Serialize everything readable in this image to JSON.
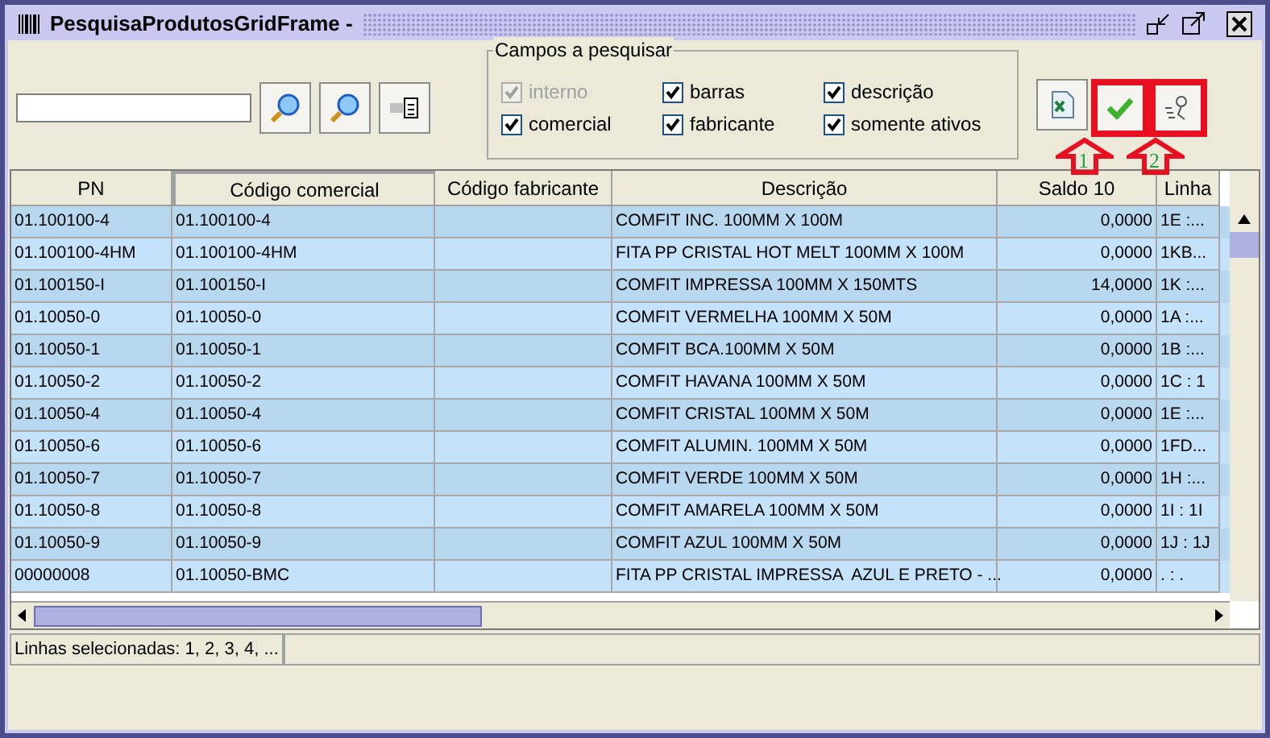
{
  "window": {
    "title": "PesquisaProdutosGridFrame -"
  },
  "fields_group": {
    "title": "Campos a pesquisar",
    "options": [
      {
        "label": "interno",
        "checked": true,
        "disabled": true
      },
      {
        "label": "comercial",
        "checked": true,
        "disabled": false
      },
      {
        "label": "barras",
        "checked": true,
        "disabled": false
      },
      {
        "label": "fabricante",
        "checked": true,
        "disabled": false
      },
      {
        "label": "descrição",
        "checked": true,
        "disabled": false
      },
      {
        "label": "somente ativos",
        "checked": true,
        "disabled": false
      }
    ]
  },
  "table": {
    "columns": [
      {
        "label": "PN",
        "sorted": false
      },
      {
        "label": "Código comercial",
        "sorted": true
      },
      {
        "label": "Código fabricante",
        "sorted": false
      },
      {
        "label": "Descrição",
        "sorted": false
      },
      {
        "label": "Saldo 10",
        "sorted": false
      },
      {
        "label": "Linha",
        "sorted": false
      }
    ],
    "rows": [
      {
        "selected": true,
        "cells": [
          "01.100100-4",
          "01.100100-4",
          "",
          "COMFIT INC. 100MM X 100M",
          "0,0000",
          "1E :..."
        ]
      },
      {
        "selected": true,
        "cells": [
          "01.100100-4HM",
          "01.100100-4HM",
          "",
          "FITA PP CRISTAL HOT MELT 100MM X 100M",
          "0,0000",
          "1KB..."
        ]
      },
      {
        "selected": true,
        "cells": [
          "01.100150-I",
          "01.100150-I",
          "",
          "COMFIT IMPRESSA 100MM X 150MTS",
          "14,0000",
          "1K :..."
        ]
      },
      {
        "selected": true,
        "cells": [
          "01.10050-0",
          "01.10050-0",
          "",
          "COMFIT VERMELHA 100MM X 50M",
          "0,0000",
          "1A :..."
        ]
      },
      {
        "selected": true,
        "cells": [
          "01.10050-1",
          "01.10050-1",
          "",
          "COMFIT BCA.100MM X 50M",
          "0,0000",
          "1B :..."
        ]
      },
      {
        "selected": true,
        "cells": [
          "01.10050-2",
          "01.10050-2",
          "",
          "COMFIT HAVANA 100MM X 50M",
          "0,0000",
          "1C : 1"
        ]
      },
      {
        "selected": true,
        "cells": [
          "01.10050-4",
          "01.10050-4",
          "",
          "COMFIT CRISTAL 100MM X 50M",
          "0,0000",
          "1E :..."
        ]
      },
      {
        "selected": true,
        "cells": [
          "01.10050-6",
          "01.10050-6",
          "",
          "COMFIT ALUMIN. 100MM X 50M",
          "0,0000",
          "1FD..."
        ]
      },
      {
        "selected": true,
        "cells": [
          "01.10050-7",
          "01.10050-7",
          "",
          "COMFIT VERDE 100MM X 50M",
          "0,0000",
          "1H :..."
        ]
      },
      {
        "selected": true,
        "cells": [
          "01.10050-8",
          "01.10050-8",
          "",
          "COMFIT AMARELA 100MM X 50M",
          "0,0000",
          "1I : 1I"
        ]
      },
      {
        "selected": true,
        "cells": [
          "01.10050-9",
          "01.10050-9",
          "",
          "COMFIT AZUL 100MM X 50M",
          "0,0000",
          "1J : 1J"
        ]
      },
      {
        "selected": true,
        "cells": [
          "00000008",
          "01.10050-BMC",
          "",
          "FITA PP CRISTAL IMPRESSA  AZUL E PRETO - ...",
          "0,0000",
          ". : ."
        ]
      }
    ]
  },
  "status_bar": {
    "text": "Linhas selecionadas: 1, 2, 3, 4, ..."
  },
  "annotations": [
    {
      "label": "1"
    },
    {
      "label": "2"
    }
  ]
}
